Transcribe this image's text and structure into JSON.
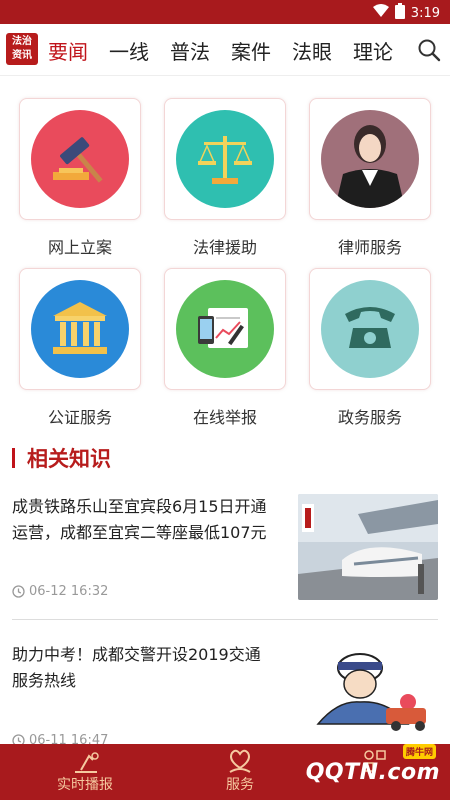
{
  "status": {
    "time": "3:19"
  },
  "nav": {
    "logo_text": "法治 资讯",
    "tabs": [
      "要闻",
      "一线",
      "普法",
      "案件",
      "法眼",
      "理论"
    ],
    "active_index": 0
  },
  "services": [
    {
      "label": "网上立案",
      "icon": "gavel-icon",
      "color": "#e94b5c"
    },
    {
      "label": "法律援助",
      "icon": "scales-icon",
      "color": "#2fbfb0"
    },
    {
      "label": "律师服务",
      "icon": "lawyer-icon",
      "color": "#a0707a"
    },
    {
      "label": "公证服务",
      "icon": "courthouse-icon",
      "color": "#2a8ad8"
    },
    {
      "label": "在线举报",
      "icon": "report-icon",
      "color": "#5cc05c"
    },
    {
      "label": "政务服务",
      "icon": "phone-icon",
      "color": "#8fd0cf"
    }
  ],
  "section": {
    "title": "相关知识"
  },
  "news": [
    {
      "title": "成贵铁路乐山至宜宾段6月15日开通运营，成都至宜宾二等座最低107元",
      "time": "06-12 16:32",
      "thumb": "train-photo"
    },
    {
      "title": "助力中考！成都交警开设2019交通服务热线",
      "time": "06-11 16:47",
      "thumb": "police-cartoon"
    }
  ],
  "bottombar": {
    "items": [
      {
        "label": "实时播报",
        "icon": "broadcast-icon"
      },
      {
        "label": "服务",
        "icon": "heart-hand-icon"
      },
      {
        "label": "",
        "icon": "grid-icon"
      }
    ],
    "watermark": "QQTN.com",
    "watermark_badge": "腾牛网"
  },
  "colors": {
    "brand": "#a81a1d",
    "accent": "#c0131a",
    "tab_label": "#f6c9a0"
  }
}
